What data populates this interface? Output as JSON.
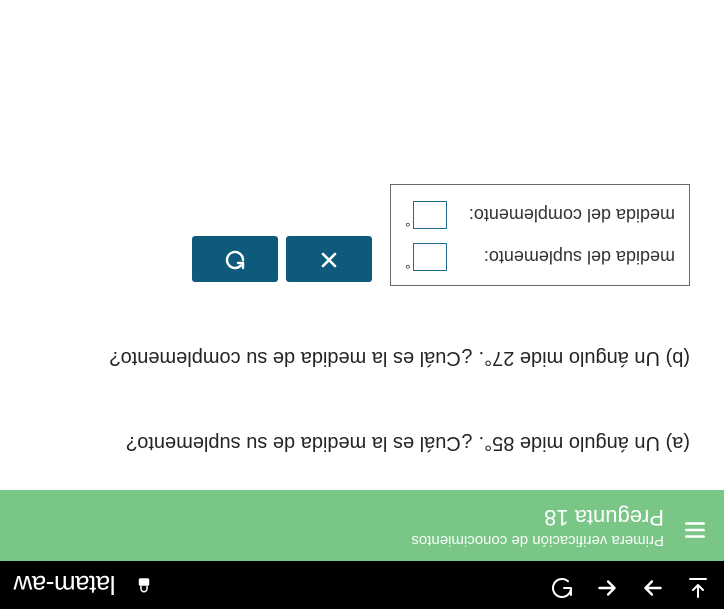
{
  "status_bar": {
    "url_fragment": "latam-aw"
  },
  "header": {
    "subtitle": "Primera verificación de conocimientos",
    "title": "Pregunta 18"
  },
  "questions": {
    "a": "(a) Un ángulo mide 85°. ¿Cuál es la medida de su suplemento?",
    "b": "(b) Un ángulo mide 27°. ¿Cuál es la medida de su complemento?"
  },
  "answers": {
    "suplemento_label": "medida del suplemento:",
    "complemento_label": "medida del complemento:",
    "degree_symbol": "°",
    "suplemento_value": "",
    "complemento_value": ""
  },
  "icons": {
    "hamburger": "hamburger-icon",
    "download": "download-icon",
    "forward": "forward-icon",
    "back": "back-icon",
    "refresh": "refresh-icon",
    "lock": "lock-icon",
    "clear": "clear-icon",
    "reset": "reset-icon"
  }
}
